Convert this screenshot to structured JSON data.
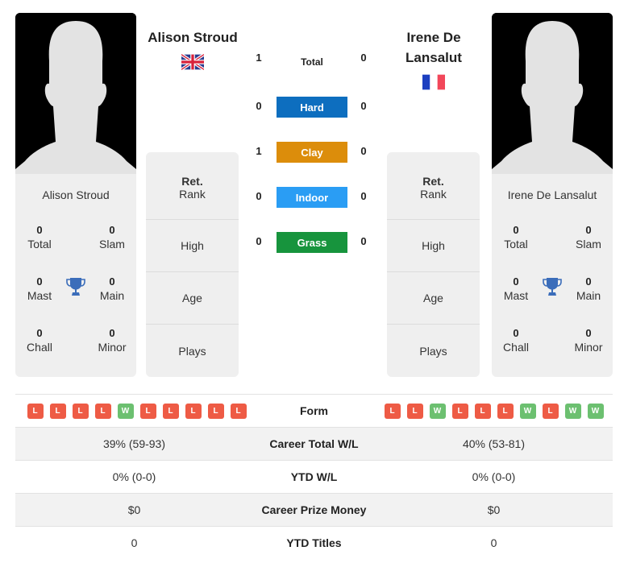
{
  "colors": {
    "hard": "#0d6ebf",
    "clay": "#dc8d0b",
    "indoor": "#2a9df4",
    "grass": "#17943d",
    "loss": "#ee5b45",
    "win": "#6cc070",
    "trophy": "#3b6dba"
  },
  "player1": {
    "name": "Alison Stroud",
    "card_name": "Alison Stroud",
    "country": "GB",
    "flag_icon": "uk-flag-icon",
    "titles": {
      "total": {
        "value": "0",
        "label": "Total"
      },
      "slam": {
        "value": "0",
        "label": "Slam"
      },
      "mast": {
        "value": "0",
        "label": "Mast"
      },
      "main": {
        "value": "0",
        "label": "Main"
      },
      "chall": {
        "value": "0",
        "label": "Chall"
      },
      "minor": {
        "value": "0",
        "label": "Minor"
      }
    },
    "info": {
      "rank_value": "Ret.",
      "rank_label": "Rank",
      "high_label": "High",
      "age_label": "Age",
      "plays_label": "Plays"
    },
    "form": [
      "L",
      "L",
      "L",
      "L",
      "W",
      "L",
      "L",
      "L",
      "L",
      "L"
    ]
  },
  "player2": {
    "name": "Irene De Lansalut",
    "card_name": "Irene De Lansalut",
    "country": "FR",
    "flag_icon": "france-flag-icon",
    "titles": {
      "total": {
        "value": "0",
        "label": "Total"
      },
      "slam": {
        "value": "0",
        "label": "Slam"
      },
      "mast": {
        "value": "0",
        "label": "Mast"
      },
      "main": {
        "value": "0",
        "label": "Main"
      },
      "chall": {
        "value": "0",
        "label": "Chall"
      },
      "minor": {
        "value": "0",
        "label": "Minor"
      }
    },
    "info": {
      "rank_value": "Ret.",
      "rank_label": "Rank",
      "high_label": "High",
      "age_label": "Age",
      "plays_label": "Plays"
    },
    "form": [
      "L",
      "L",
      "W",
      "L",
      "L",
      "L",
      "W",
      "L",
      "W",
      "W"
    ]
  },
  "h2h": [
    {
      "label": "Total",
      "p1": "1",
      "p2": "0",
      "surface": "total"
    },
    {
      "label": "Hard",
      "p1": "0",
      "p2": "0",
      "surface": "hard"
    },
    {
      "label": "Clay",
      "p1": "1",
      "p2": "0",
      "surface": "clay"
    },
    {
      "label": "Indoor",
      "p1": "0",
      "p2": "0",
      "surface": "indoor"
    },
    {
      "label": "Grass",
      "p1": "0",
      "p2": "0",
      "surface": "grass"
    }
  ],
  "stats": {
    "form_label": "Form",
    "rows": [
      {
        "label": "Career Total W/L",
        "p1": "39% (59-93)",
        "p2": "40% (53-81)"
      },
      {
        "label": "YTD W/L",
        "p1": "0% (0-0)",
        "p2": "0% (0-0)"
      },
      {
        "label": "Career Prize Money",
        "p1": "$0",
        "p2": "$0"
      },
      {
        "label": "YTD Titles",
        "p1": "0",
        "p2": "0"
      }
    ]
  }
}
